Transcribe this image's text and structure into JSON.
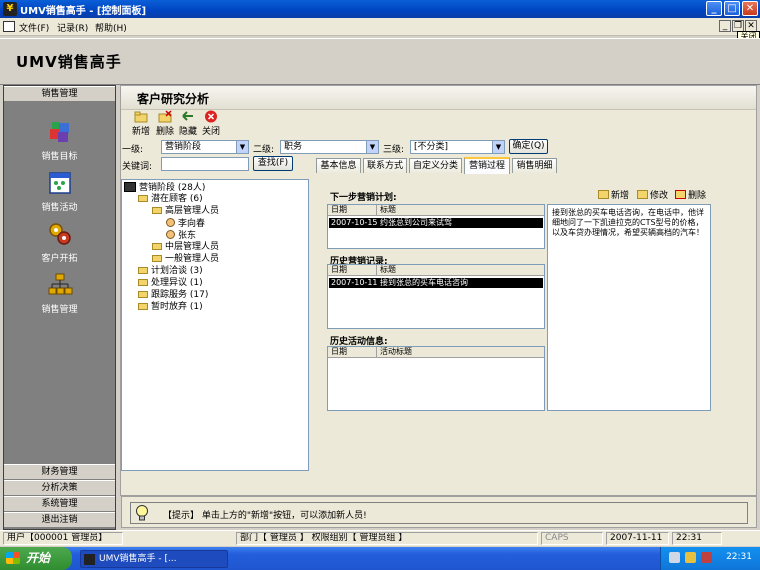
{
  "window": {
    "title": "UMV销售高手 - [控制面板]",
    "close_tooltip": "关闭"
  },
  "menu": {
    "items": [
      "文件(F)",
      "记录(R)",
      "帮助(H)"
    ]
  },
  "app": {
    "title": "UMV销售高手"
  },
  "nav": {
    "sections": [
      "销售管理",
      "财务管理",
      "分析决策",
      "系统管理",
      "退出注销"
    ],
    "items": [
      {
        "label": "销售目标",
        "icon": "cubes-icon"
      },
      {
        "label": "销售活动",
        "icon": "calendar-icon"
      },
      {
        "label": "客户开拓",
        "icon": "gears-icon"
      },
      {
        "label": "销售管理",
        "icon": "org-chart-icon"
      }
    ]
  },
  "panel": {
    "title": "客户研究分析",
    "toolbar": [
      "新增",
      "删除",
      "隐藏",
      "关闭"
    ],
    "filters": {
      "level1_label": "一级:",
      "level1_value": "营销阶段",
      "level2_label": "二级:",
      "level2_value": "职务",
      "level3_label": "三级:",
      "level3_value": "[不分类]",
      "confirm": "确定(Q)",
      "keyword_label": "关键词:",
      "keyword_value": "",
      "search": "查找(F)"
    },
    "tabs": [
      "基本信息",
      "联系方式",
      "自定义分类",
      "营销过程",
      "销售明细"
    ],
    "active_tab": 3
  },
  "tree": [
    {
      "label": "营销阶段 (28人)",
      "level": 0,
      "icon": "root"
    },
    {
      "label": "潜在顾客 (6)",
      "level": 1,
      "icon": "folder"
    },
    {
      "label": "高层管理人员",
      "level": 2,
      "icon": "folder"
    },
    {
      "label": "李向春",
      "level": 3,
      "icon": "person"
    },
    {
      "label": "张东",
      "level": 3,
      "icon": "person"
    },
    {
      "label": "中层管理人员",
      "level": 2,
      "icon": "folder"
    },
    {
      "label": "一般管理人员",
      "level": 2,
      "icon": "folder"
    },
    {
      "label": "计划洽谈 (3)",
      "level": 1,
      "icon": "folder"
    },
    {
      "label": "处理异议 (1)",
      "level": 1,
      "icon": "folder"
    },
    {
      "label": "跟踪服务 (17)",
      "level": 1,
      "icon": "folder"
    },
    {
      "label": "暂时放弃 (1)",
      "level": 1,
      "icon": "folder"
    }
  ],
  "process": {
    "next_plan_label": "下一步营销计划:",
    "actions": [
      "新增",
      "修改",
      "删除"
    ],
    "plan_columns": [
      "日期",
      "标题"
    ],
    "plan_rows": [
      {
        "date": "2007-10-15",
        "title": "约张总到公司来试驾"
      }
    ],
    "history_label": "历史营销记录:",
    "history_columns": [
      "日期",
      "标题"
    ],
    "history_rows": [
      {
        "date": "2007-10-11",
        "title": "接到张总的买车电话咨询"
      }
    ],
    "activity_label": "历史活动信息:",
    "activity_columns": [
      "日期",
      "活动标题"
    ],
    "note": "接到张总的买车电话咨询，在电话中，他详细地问了一下凯迪拉克的CTS型号的价格，以及车贷办理情况，希望买辆高档的汽车！"
  },
  "tip": {
    "text": "【提示】 单击上方的\"新增\"按钮，可以添加新人员!"
  },
  "status": {
    "user": "用户【000001 管理员】",
    "dept": "部门【 管理员 】 权限组别【 管理员组 】",
    "caps": "CAPS",
    "date": "2007-11-11",
    "time": "22:31"
  },
  "taskbar": {
    "start": "开始",
    "item": "UMV销售高手 - [...",
    "clock": "22:31"
  }
}
